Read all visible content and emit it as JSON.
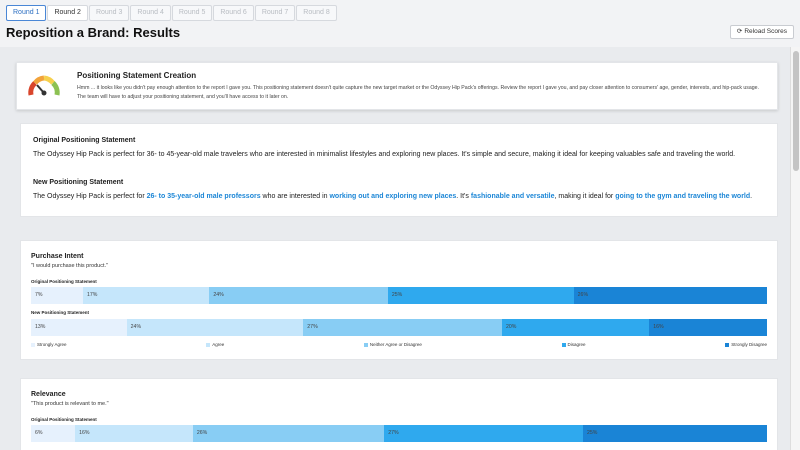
{
  "tabs": [
    "Round 1",
    "Round 2",
    "Round 3",
    "Round 4",
    "Round 5",
    "Round 6",
    "Round 7",
    "Round 8"
  ],
  "active_tab": 0,
  "title": "Reposition a Brand: Results",
  "reload_label": "Reload Scores",
  "alert": {
    "title": "Positioning Statement Creation",
    "message": "Hmm ... it looks like you didn't pay enough attention to the report I gave you. This positioning statement doesn't quite capture the new target market or the Odyssey Hip Pack's offerings. Review the report I gave you, and pay closer attention to consumers' age, gender, interests, and hip-pack usage. The team will have to adjust your positioning statement, and you'll have access to it later on."
  },
  "statements": {
    "original_heading": "Original Positioning Statement",
    "original_text": "The Odyssey Hip Pack is perfect for 36- to 45-year-old male travelers who are interested in minimalist lifestyles and exploring new places. It's simple and secure, making it ideal for keeping valuables safe and traveling the world.",
    "new_heading": "New Positioning Statement",
    "new_parts": {
      "p1": "The Odyssey Hip Pack is perfect for ",
      "h1": "26- to 35-year-old male professors",
      "p2": " who are interested in ",
      "h2": "working out and exploring new places",
      "p3": ". It's ",
      "h3": "fashionable and versatile",
      "p4": ", making it ideal for ",
      "h4": "going to the gym and traveling the world",
      "p5": "."
    }
  },
  "colors": [
    "#e6f1fd",
    "#c5e6fb",
    "#88cdf4",
    "#2fa9ee",
    "#1a84d6"
  ],
  "legend": [
    "Strongly Agree",
    "Agree",
    "Neither Agree or Disagree",
    "Disagree",
    "Strongly Disagree"
  ],
  "purchase_intent": {
    "title": "Purchase Intent",
    "quote": "\"I would purchase this product.\"",
    "original_label": "Original Positioning Statement",
    "original": [
      7,
      17,
      24,
      25,
      26
    ],
    "new_label": "New Positioning Statement",
    "new": [
      13,
      24,
      27,
      20,
      16
    ],
    "original_text": [
      "7%",
      "17%",
      "24%",
      "25%",
      "26%"
    ],
    "new_text": [
      "13%",
      "24%",
      "27%",
      "20%",
      "16%"
    ]
  },
  "relevance": {
    "title": "Relevance",
    "quote": "\"This product is relevant to me.\"",
    "original_label": "Original Positioning Statement",
    "original": [
      6,
      16,
      26,
      27,
      25
    ],
    "original_text": [
      "6%",
      "16%",
      "26%",
      "27%",
      "25%"
    ]
  }
}
